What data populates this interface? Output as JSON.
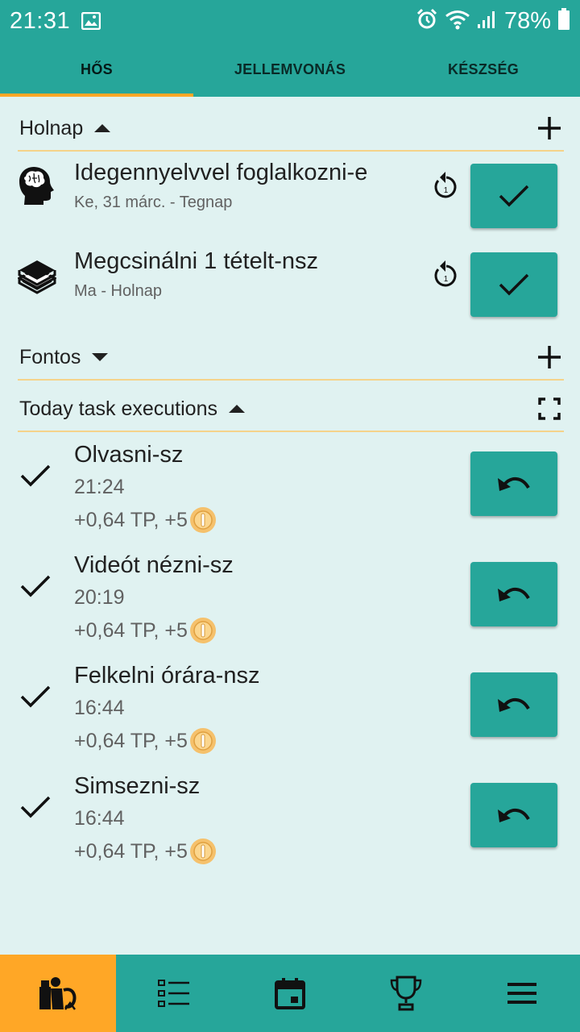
{
  "status_bar": {
    "time": "21:31",
    "battery_percent": "78%",
    "icons": [
      "image-icon",
      "alarm-icon",
      "wifi-icon",
      "signal-icon",
      "battery-icon"
    ]
  },
  "tabs": [
    {
      "label": "HŐS",
      "active": true
    },
    {
      "label": "JELLEMVONÁS",
      "active": false
    },
    {
      "label": "KÉSZSÉG",
      "active": false
    }
  ],
  "sections": {
    "tomorrow": {
      "title": "Holnap",
      "expanded": true
    },
    "important": {
      "title": "Fontos",
      "expanded": false
    },
    "today_exec": {
      "title": "Today task executions",
      "expanded": true
    }
  },
  "tasks": [
    {
      "name": "Idegennyelvvel foglalkozni-e",
      "subtitle": "Ke, 31 márc. - Tegnap",
      "icon": "brain-head-icon",
      "repeat_count": "1"
    },
    {
      "name": "Megcsinálni 1 tételt-nsz",
      "subtitle": "Ma - Holnap",
      "icon": "books-icon",
      "repeat_count": "1"
    }
  ],
  "executions": [
    {
      "name": "Olvasni-sz",
      "time": "21:24",
      "reward": "+0,64 TP, +5"
    },
    {
      "name": "Videót nézni-sz",
      "time": "20:19",
      "reward": "+0,64 TP, +5"
    },
    {
      "name": "Felkelni órára-nsz",
      "time": "16:44",
      "reward": "+0,64 TP, +5"
    },
    {
      "name": "Simsezni-sz",
      "time": "16:44",
      "reward": "+0,64 TP, +5"
    }
  ],
  "bottom_nav": [
    {
      "icon": "hero-icon",
      "active": true
    },
    {
      "icon": "list-icon",
      "active": false
    },
    {
      "icon": "calendar-icon",
      "active": false
    },
    {
      "icon": "trophy-icon",
      "active": false
    },
    {
      "icon": "menu-icon",
      "active": false
    }
  ],
  "colors": {
    "primary": "#26a69a",
    "accent": "#ffa726",
    "background": "#e0f2f1",
    "divider": "#f5d38a"
  }
}
